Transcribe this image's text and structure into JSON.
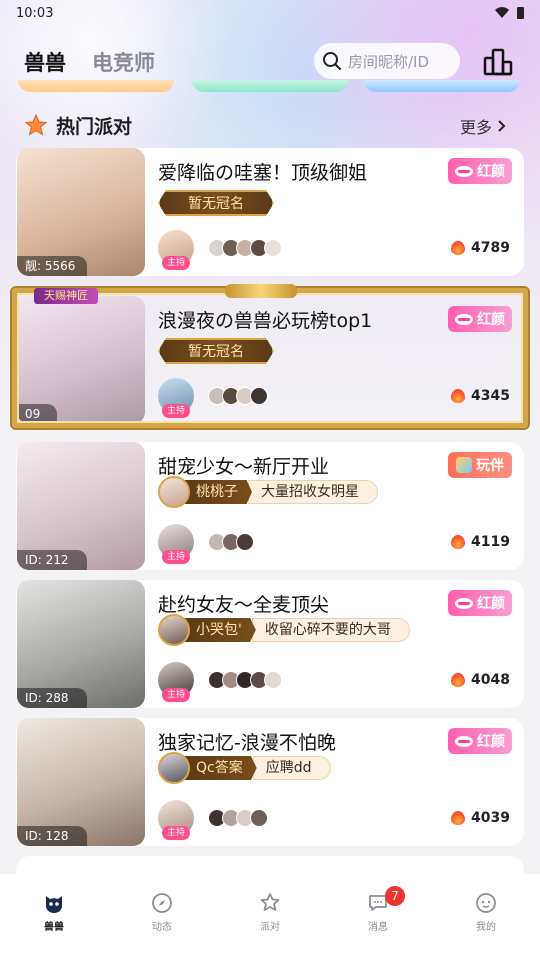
{
  "status": {
    "time": "10:03"
  },
  "header": {
    "tabs": [
      "兽兽",
      "电竞师"
    ],
    "search_placeholder": "房间昵称/ID"
  },
  "section": {
    "title": "热门派对",
    "more": "更多"
  },
  "rooms": [
    {
      "title": "爱降临の哇塞！顶级御姐",
      "thumb_tag": "靓: 5566",
      "badge": "红颜",
      "badge_type": "red",
      "crown": "暂无冠名",
      "host_label": "主持",
      "heat": "4789",
      "colors": [
        "#f1d8c4",
        "#c89a7a"
      ]
    },
    {
      "title": "浪漫夜の兽兽必玩榜top1",
      "thumb_tag": "09",
      "badge": "红颜",
      "badge_type": "red",
      "crown": "暂无冠名",
      "host_label": "主持",
      "heat": "4345",
      "frame_tag": "天赐神匠",
      "colors": [
        "#e7d6e8",
        "#b9a4b6"
      ]
    },
    {
      "title": "甜宠少女～新厅开业",
      "thumb_tag": "ID: 212",
      "badge": "玩伴",
      "badge_type": "mate",
      "guard_name": "桃桃子",
      "guard_note": "大量招收女明星",
      "host_label": "主持",
      "heat": "4119",
      "colors": [
        "#efe4ea",
        "#c9b3bb"
      ]
    },
    {
      "title": "赴约女友～全麦顶尖",
      "thumb_tag": "ID: 288",
      "badge": "红颜",
      "badge_type": "red",
      "guard_name": "小哭包'",
      "guard_note": "收留心碎不要的大哥",
      "host_label": "主持",
      "heat": "4048",
      "colors": [
        "#d9dad9",
        "#8b8b8a"
      ]
    },
    {
      "title": "独家记忆-浪漫不怕晚",
      "thumb_tag": "ID: 128",
      "badge": "红颜",
      "badge_type": "red",
      "guard_name": "Qc答案",
      "guard_note": "应聘dd",
      "host_label": "主持",
      "heat": "4039",
      "colors": [
        "#e6dfd8",
        "#9c8c80"
      ]
    }
  ],
  "nav": [
    {
      "label": "兽兽",
      "icon": "beast-icon",
      "active": true
    },
    {
      "label": "动态",
      "icon": "compass-icon"
    },
    {
      "label": "派对",
      "icon": "party-icon"
    },
    {
      "label": "消息",
      "icon": "message-icon",
      "count": "7"
    },
    {
      "label": "我的",
      "icon": "profile-icon"
    }
  ],
  "accent": "#ff4d8d"
}
